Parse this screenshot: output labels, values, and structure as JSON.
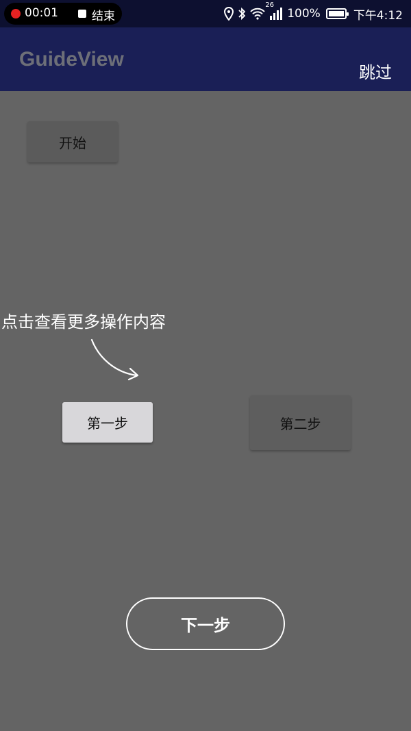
{
  "status_bar": {
    "recording_time": "00:01",
    "recording_end": "结束",
    "network_label": "26",
    "battery": "100%",
    "time": "下午4:12"
  },
  "app_bar": {
    "title": "GuideView",
    "skip_label": "跳过"
  },
  "buttons": {
    "start": "开始",
    "step1": "第一步",
    "step2": "第二步",
    "next": "下一步"
  },
  "guide": {
    "hint": "点击查看更多操作内容"
  },
  "colors": {
    "status_bar": "#0d1030",
    "app_bar": "#1a1f56",
    "overlay": "#646464",
    "highlight_button": "#d8d7da"
  }
}
